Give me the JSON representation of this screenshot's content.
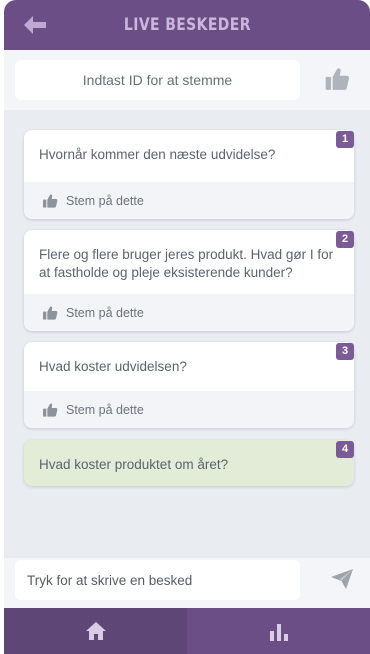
{
  "header": {
    "title": "LIVE BESKEDER",
    "back_icon": "arrow-left-icon"
  },
  "vote_bar": {
    "placeholder": "Indtast ID for at stemme",
    "vote_icon": "thumbs-up-icon"
  },
  "messages": [
    {
      "id": "1",
      "text": "Hvornår kommer den næste udvidelse?",
      "vote_label": "Stem på dette"
    },
    {
      "id": "2",
      "text": "Flere og flere bruger jeres produkt. Hvad gør I for at fastholde og pleje eksisterende kunder?",
      "vote_label": "Stem på dette"
    },
    {
      "id": "3",
      "text": "Hvad koster udvidelsen?",
      "vote_label": "Stem på dette"
    },
    {
      "id": "4",
      "text": "Hvad koster produktet om året?",
      "highlighted": true
    }
  ],
  "compose": {
    "placeholder": "Tryk for at skrive en besked",
    "send_icon": "send-icon"
  },
  "tabs": [
    {
      "name": "home",
      "icon": "home-icon",
      "active": true
    },
    {
      "name": "stats",
      "icon": "bar-chart-icon",
      "active": false
    }
  ],
  "colors": {
    "header": "#6b4e86",
    "title": "#cbb6dc",
    "badge": "#7a5a97",
    "highlight": "#e3ecd6",
    "background": "#e9edf2",
    "tab_active": "#5e4777"
  }
}
